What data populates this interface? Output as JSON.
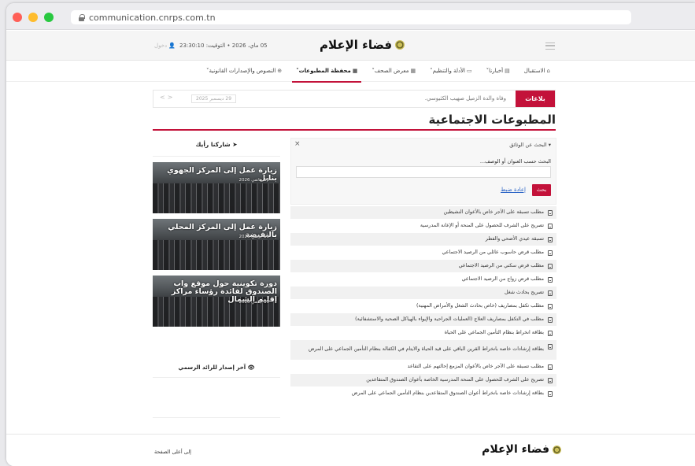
{
  "browser": {
    "url": "communication.cnrps.com.tn"
  },
  "topbar": {
    "site_name": "فضاء الإعلام",
    "date": "05 ماي، 2026",
    "time_label": "التوقيت:",
    "time": "23:30:10",
    "login": "دخول"
  },
  "nav": {
    "items": [
      {
        "label": "الاستقبال",
        "icon": "home-icon"
      },
      {
        "label": "أخبارنا",
        "icon": "news-icon"
      },
      {
        "label": "الأدلة والتنظيم",
        "icon": "folder-icon"
      },
      {
        "label": "معرض الصحف",
        "icon": "newspaper-icon"
      },
      {
        "label": "محفظة المطبوعات",
        "icon": "briefcase-icon",
        "active": true
      },
      {
        "label": "النصوص والإصدارات القانونية",
        "icon": "globe-icon"
      }
    ]
  },
  "ticker": {
    "label": "بلاغات",
    "text": "وفاة والدة الزميل صهيب الكثيوسي.",
    "date": "29 ديسمبر 2025"
  },
  "page": {
    "title": "المطبوعات الاجتماعية"
  },
  "search": {
    "title": "البحث عن الوثائق",
    "field_label": "البحث حسب العنوان أو الوصف...",
    "value": "",
    "submit_label": "بحث",
    "reset_label": "إعادة ضبط"
  },
  "documents": [
    "مطلب تسبقة على الأجر خاص بالأعوان النشيطين",
    "تصريح على الشرف للحصول على المنحة أو الإعانة المدرسية",
    "تسبقة عيدي الأضحى والفطر",
    "مطلب قرض حاسوب عائلي من الرصيد الاجتماعي",
    "مطلب قرض سكني من الرصيد الاجتماعي",
    "مطلب قرض زواج من الرصيد الاجتماعي",
    "تصريح بحادث شغل",
    "مطلب تكفل بمصاريف (خاص بحادث الشغل والأمراض المهنية)",
    "مطلب في التكفل بمصاريف العلاج (العمليات الجراحية والإيواء بالهياكل الصحية والاستشفائية)",
    "بطاقة انخراط بنظام التأمين الجماعي على الحياة",
    "بطاقة إرشادات خاصة بانخراط القرين الباقي على قيد الحياة والايتام في الكفالة بنظام التأمين الجماعي على المرض",
    "مطلب تسبقة على الأجر خاص بالأعوان المزمع إحالتهم على التقاعد",
    "تصريح على الشرف للحصول على المنحة المدرسية الخاصة بأعوان الصندوق المتقاعدين",
    "بطاقة إرشادات خاصة بانخراط أعوان الصندوق المتقاعدين بنظام التأمين الجماعي على المرض"
  ],
  "sidebar": {
    "share_heading": "شاركنا رأيك",
    "cards": [
      {
        "title": "زيارة عمل إلى المركز الجهوي بنابل",
        "date": "19 جانفي 2026"
      },
      {
        "title": "زيارة عمل إلى المركز المحلي بالنفيضة",
        "date": "19 جانفي 2026"
      },
      {
        "title": "دورة تكوينية حول موقع واب الصندوق لفائدة رؤساء مراكز إقليم الشمال",
        "date": "09 جانفي 2026"
      }
    ],
    "gazette_heading": "آخر إصدار للرائد الرسمي"
  },
  "footer": {
    "site_name": "فضاء الإعلام",
    "back_to_top": "إلى أعلى الصفحة"
  },
  "colors": {
    "accent": "#c3123a",
    "link": "#2560c4"
  }
}
